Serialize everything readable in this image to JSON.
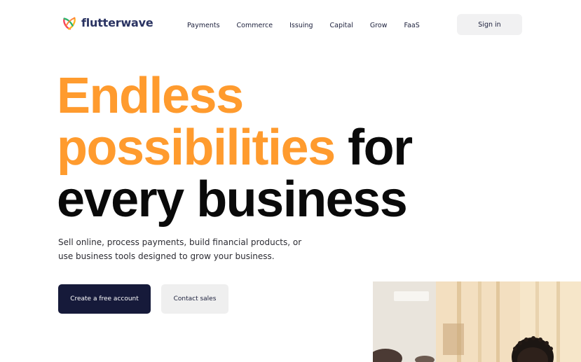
{
  "brand": {
    "name": "flutterwave",
    "colors": {
      "orange": "#ff9b2e",
      "navy": "#161a3a",
      "logo_red": "#f5455c",
      "logo_yellow": "#ffb624",
      "logo_green": "#2bb66a",
      "logo_blue": "#2a3362"
    },
    "logo_icon": "flutterwave-logo-icon"
  },
  "nav": {
    "items": [
      {
        "label": "Payments"
      },
      {
        "label": "Commerce"
      },
      {
        "label": "Issuing"
      },
      {
        "label": "Capital"
      },
      {
        "label": "Grow"
      },
      {
        "label": "FaaS"
      }
    ]
  },
  "header": {
    "signin_label": "Sign in"
  },
  "hero": {
    "title_line1": "Endless",
    "title_line2_highlight": "possibilities",
    "title_line2_rest": " for",
    "title_line3": "every business",
    "subtitle_line1": "Sell online, process payments, build financial products, or",
    "subtitle_line2": "use business tools designed to grow your business.",
    "primary_cta": "Create a free account",
    "secondary_cta": "Contact sales"
  }
}
